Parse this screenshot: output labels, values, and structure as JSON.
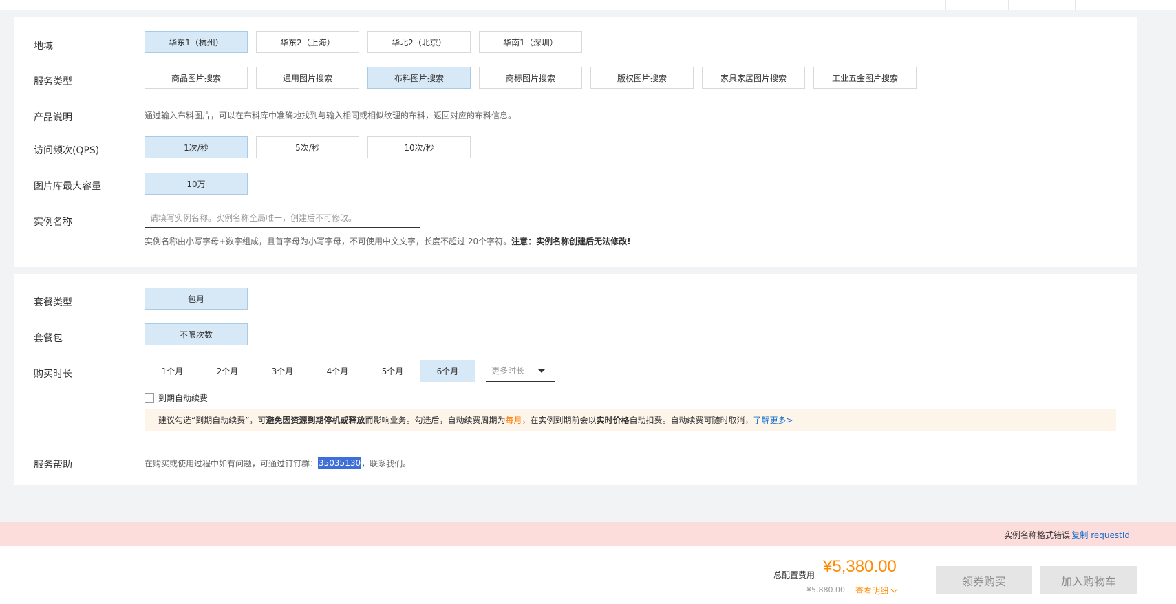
{
  "region": {
    "label": "地域",
    "options": [
      "华东1（杭州）",
      "华东2（上海）",
      "华北2（北京）",
      "华南1（深圳）"
    ],
    "selected": "华东1（杭州）"
  },
  "service_type": {
    "label": "服务类型",
    "options": [
      "商品图片搜索",
      "通用图片搜索",
      "布料图片搜索",
      "商标图片搜索",
      "版权图片搜索",
      "家具家居图片搜索",
      "工业五金图片搜索"
    ],
    "selected": "布料图片搜索"
  },
  "product_desc": {
    "label": "产品说明",
    "text": "通过输入布料图片，可以在布料库中准确地找到与输入相同或相似纹理的布料，返回对应的布料信息。"
  },
  "qps": {
    "label": "访问频次(QPS)",
    "options": [
      "1次/秒",
      "5次/秒",
      "10次/秒"
    ],
    "selected": "1次/秒"
  },
  "capacity": {
    "label": "图片库最大容量",
    "options": [
      "10万"
    ],
    "selected": "10万"
  },
  "instance_name": {
    "label": "实例名称",
    "value": "",
    "placeholder": "请填写实例名称。实例名称全局唯一，创建后不可修改。",
    "hint": "实例名称由小写字母+数字组成，且首字母为小写字母，不可使用中文文字，长度不超过 20个字符。",
    "hint_bold": "注意：实例名称创建后无法修改!"
  },
  "package_type": {
    "label": "套餐类型",
    "options": [
      "包月"
    ],
    "selected": "包月"
  },
  "package": {
    "label": "套餐包",
    "options": [
      "不限次数"
    ],
    "selected": "不限次数"
  },
  "duration": {
    "label": "购买时长",
    "options": [
      "1个月",
      "2个月",
      "3个月",
      "4个月",
      "5个月",
      "6个月"
    ],
    "selected": "6个月",
    "more_label": "更多时长"
  },
  "auto_renew": {
    "label": "到期自动续费",
    "checked": false
  },
  "notice": {
    "p1": "建议勾选“到期自动续费”，可",
    "b1": "避免因资源到期停机或释放",
    "p2": "而影响业务。勾选后，自动续费周期为 ",
    "period": "每月",
    "p3": "，在实例到期前会以",
    "b2": "实时价格",
    "p4": "自动扣费。自动续费可随时取消，",
    "link": "了解更多>"
  },
  "help": {
    "label": "服务帮助",
    "p1": "在购买或使用过程中如有问题，可通过钉钉群：",
    "group": "35035130",
    "p2": "，联系我们。"
  },
  "error": {
    "message": "实例名称格式错误",
    "copy": "复制 requestId"
  },
  "footer": {
    "total_label": "总配置费用",
    "price": "¥5,380.00",
    "original_price": "¥5,880.00",
    "detail": "查看明细",
    "coupon_button": "领券购买",
    "cart_button": "加入购物车"
  },
  "colors": {
    "selected_bg": "#d7e8f7",
    "price": "#ff8a00",
    "link": "#1a6fc9",
    "error_bg": "#fddcdc",
    "notice_bg": "#fdf4ea"
  }
}
